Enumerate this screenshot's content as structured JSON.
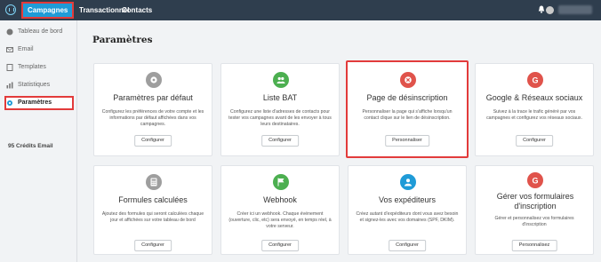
{
  "topbar": {
    "tabs": [
      {
        "label": "Campagnes",
        "active": true
      },
      {
        "label": "Transactionnel",
        "active": false
      },
      {
        "label": "Contacts",
        "active": false
      }
    ]
  },
  "sidebar": {
    "items": [
      {
        "label": "Tableau de bord",
        "icon": "dashboard-icon"
      },
      {
        "label": "Email",
        "icon": "email-icon"
      },
      {
        "label": "Templates",
        "icon": "template-icon"
      },
      {
        "label": "Statistiques",
        "icon": "stats-icon"
      },
      {
        "label": "Paramètres",
        "icon": "gear-icon",
        "active": true
      }
    ],
    "credits": "95 Crédits Email"
  },
  "main": {
    "title": "Paramètres",
    "cards": [
      {
        "title": "Paramètres par défaut",
        "desc": "Configurez les préférences de votre compte et les informations par défaut affichées dans vos campagnes.",
        "button": "Configurer",
        "icon": "gear-icon",
        "color": "#9e9e9e"
      },
      {
        "title": "Liste BAT",
        "desc": "Configurez une liste d'adresses de contacts pour tester vos campagnes avant de les envoyer à tous leurs destinataires.",
        "button": "Configurer",
        "icon": "users-icon",
        "color": "#4caf50"
      },
      {
        "title": "Page de désinscription",
        "desc": "Personnaliser la page qui s'affiche lorsqu'un contact clique sur le lien de désinscription.",
        "button": "Personnaliser",
        "icon": "close-circle-icon",
        "color": "#e0534b",
        "highlighted": true
      },
      {
        "title": "Google & Réseaux sociaux",
        "desc": "Suivez à la trace le trafic généré par vos campagnes et configurez vos réseaux sociaux.",
        "button": "Configurer",
        "icon": "google-icon",
        "color": "#e0534b"
      },
      {
        "title": "Formules calculées",
        "desc": "Ajoutez des formules qui seront calculées chaque jour et affichées sur votre tableau de bord",
        "button": "Configurer",
        "icon": "calculator-icon",
        "color": "#9e9e9e"
      },
      {
        "title": "Webhook",
        "desc": "Créer ici un webhook. Chaque événement (ouverture, clic, etc) sera envoyé, en temps réel, à votre serveur.",
        "button": "Configurer",
        "icon": "flag-icon",
        "color": "#4caf50"
      },
      {
        "title": "Vos expéditeurs",
        "desc": "Créez autant d'expéditeurs dont vous avez besoin et signez-les avec vos domaines (SPF, DKIM).",
        "button": "Configurer",
        "icon": "user-icon",
        "color": "#1f9bd7"
      },
      {
        "title": "Gérer vos formulaires d'inscription",
        "desc": "Gérer et personnalisez vos formulaires d'inscription",
        "button": "Personnalisez",
        "icon": "google-icon",
        "color": "#e0534b"
      }
    ]
  }
}
